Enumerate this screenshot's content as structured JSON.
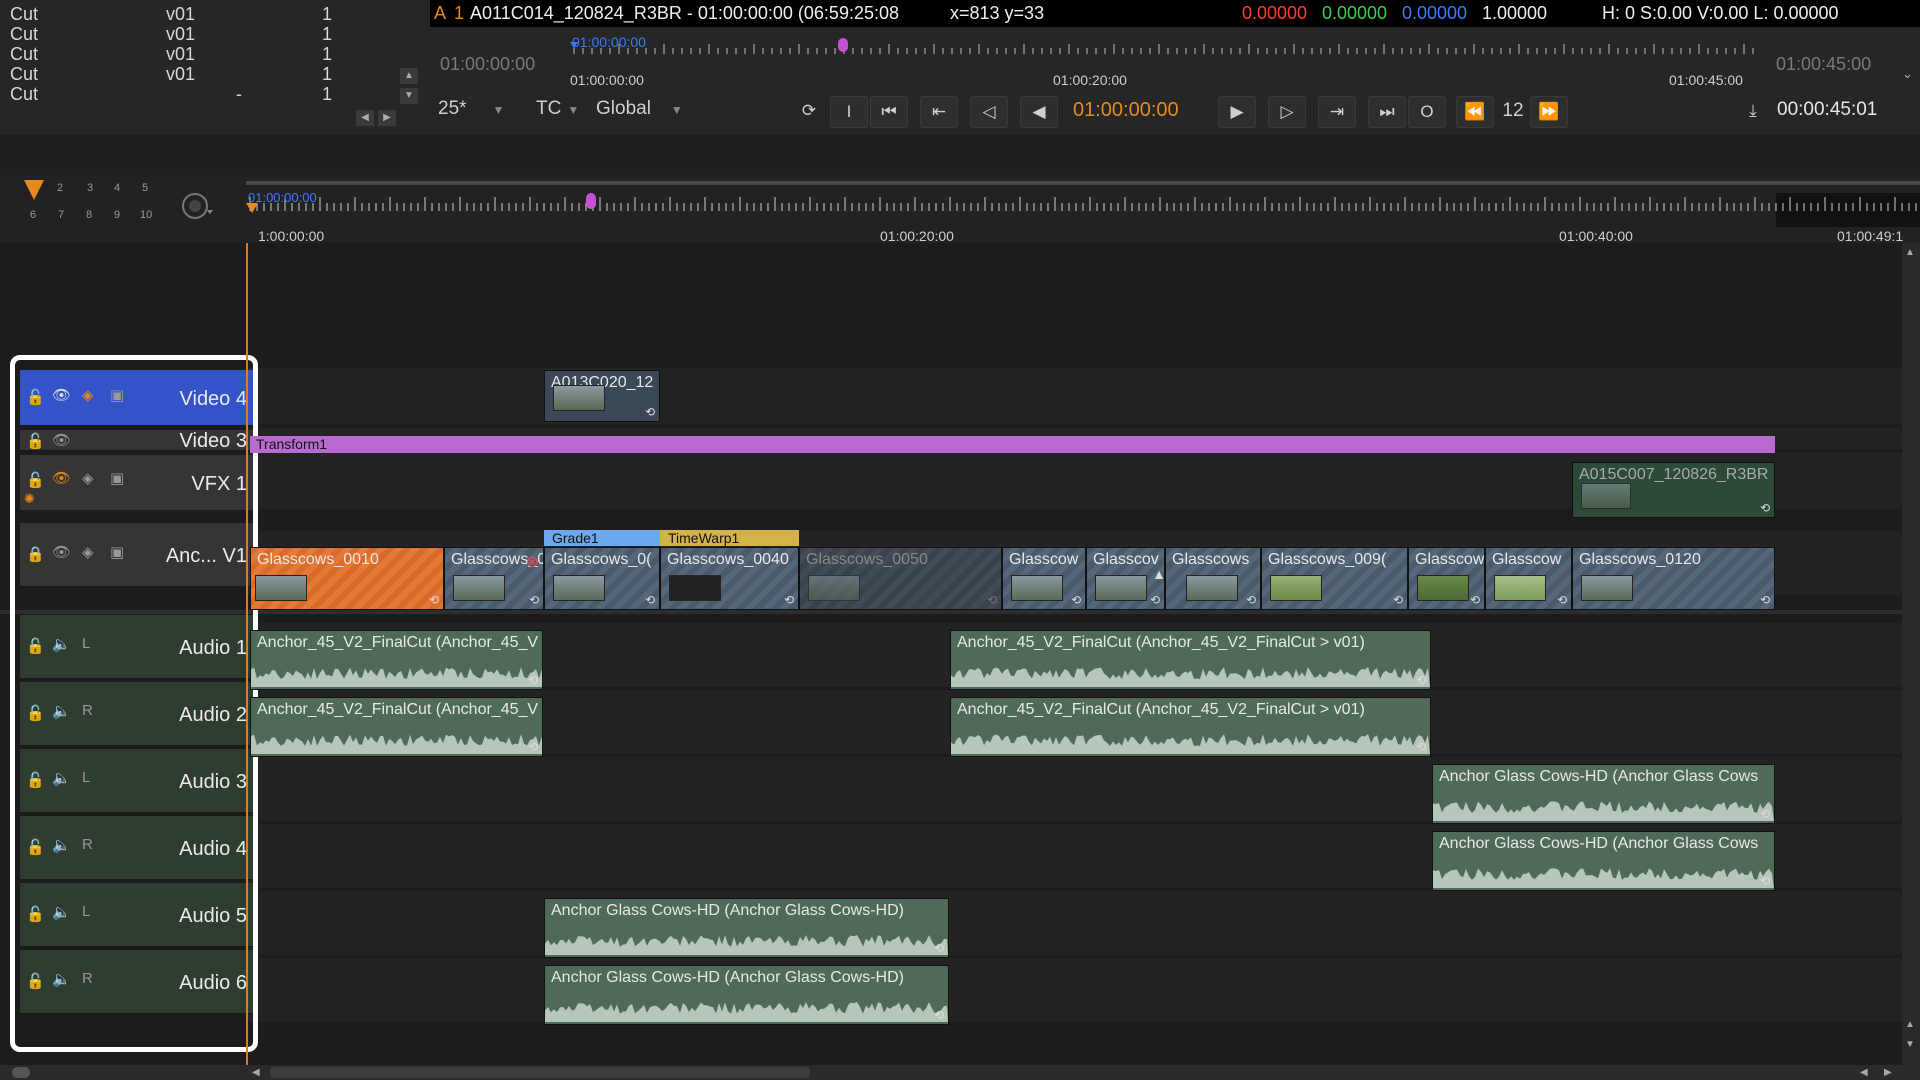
{
  "edit_list": {
    "rows": [
      {
        "type": "Cut",
        "version": "v01",
        "count": "1"
      },
      {
        "type": "Cut",
        "version": "v01",
        "count": "1"
      },
      {
        "type": "Cut",
        "version": "v01",
        "count": "1"
      },
      {
        "type": "Cut",
        "version": "v01",
        "count": "1"
      },
      {
        "type": "Cut",
        "version": "-",
        "count": "1"
      }
    ]
  },
  "viewer": {
    "info": {
      "layer": "A",
      "channel": "1",
      "clip_and_timecode": "A011C014_120824_R3BR - 01:00:00:00 (06:59:25:08",
      "coords": "x=813 y=33",
      "r": "0.00000",
      "g": "0.00000",
      "b": "0.00000",
      "a": "1.00000",
      "hsvl": "H:  0 S:0.00 V:0.00  L: 0.00000"
    },
    "ruler": {
      "in_tc": "01:00:00:00",
      "playhead_tc": "01:00:00:00",
      "start_label": "01:00:00:00",
      "mid_label": "01:00:20:00",
      "end_label": "01:00:45:00",
      "out_tc": "01:00:45:00"
    },
    "transport": {
      "fps": "25*",
      "timecode_mode": "TC",
      "scope": "Global",
      "in_button": "I",
      "out_button": "O",
      "current_tc": "01:00:00:00",
      "frame_increment": "12",
      "duration": "00:00:45:01"
    }
  },
  "timeline": {
    "markers_row1": [
      "2",
      "3",
      "4",
      "5"
    ],
    "markers_row2": [
      "6",
      "7",
      "8",
      "9",
      "10"
    ],
    "ruler_start_tc": "01:00:00:00",
    "ruler_labels": [
      "1:00:00:00",
      "01:00:20:00",
      "01:00:40:00",
      "01:00:49:1"
    ],
    "tracks": [
      {
        "name": "Video 4"
      },
      {
        "name": "Video 3"
      },
      {
        "name": "VFX 1"
      },
      {
        "name": "Anc... V1"
      },
      {
        "name": "Audio 1",
        "channel": "L"
      },
      {
        "name": "Audio 2",
        "channel": "R"
      },
      {
        "name": "Audio 3",
        "channel": "L"
      },
      {
        "name": "Audio 4",
        "channel": "R"
      },
      {
        "name": "Audio 5",
        "channel": "L"
      },
      {
        "name": "Audio 6",
        "channel": "R"
      }
    ],
    "clips": {
      "video4_clip": "A013C020_12",
      "transform": "Transform1",
      "vfx_clip": "A015C007_120826_R3BR",
      "grade": "Grade1",
      "timewarp": "TimeWarp1",
      "v1": [
        "Glasscows_0010",
        "Glasscows_0",
        "Glasscows_0(",
        "Glasscows_0040",
        "Glasscows_0050",
        "Glasscow",
        "Glasscov",
        "Glasscows",
        "Glasscows_009(",
        "Glasscow",
        "Glasscow",
        "Glasscows_0120"
      ],
      "audio_anchor_a": "Anchor_45_V2_FinalCut (Anchor_45_V",
      "audio_anchor_b": "Anchor_45_V2_FinalCut (Anchor_45_V2_FinalCut > v01)",
      "audio_glass": "Anchor Glass Cows-HD (Anchor Glass Cows-HD)",
      "audio_glass_short": "Anchor Glass Cows-HD (Anchor Glass Cows"
    }
  },
  "colors": {
    "accent_orange": "#e88a1a",
    "red": "#ff3b30",
    "green": "#3ccf4e",
    "blue": "#3a7bff",
    "track_selected": "#3553c9",
    "transform_bar": "#b96ad0",
    "grade_tab": "#6aa8f0",
    "timewarp_tab": "#d4b24a"
  }
}
